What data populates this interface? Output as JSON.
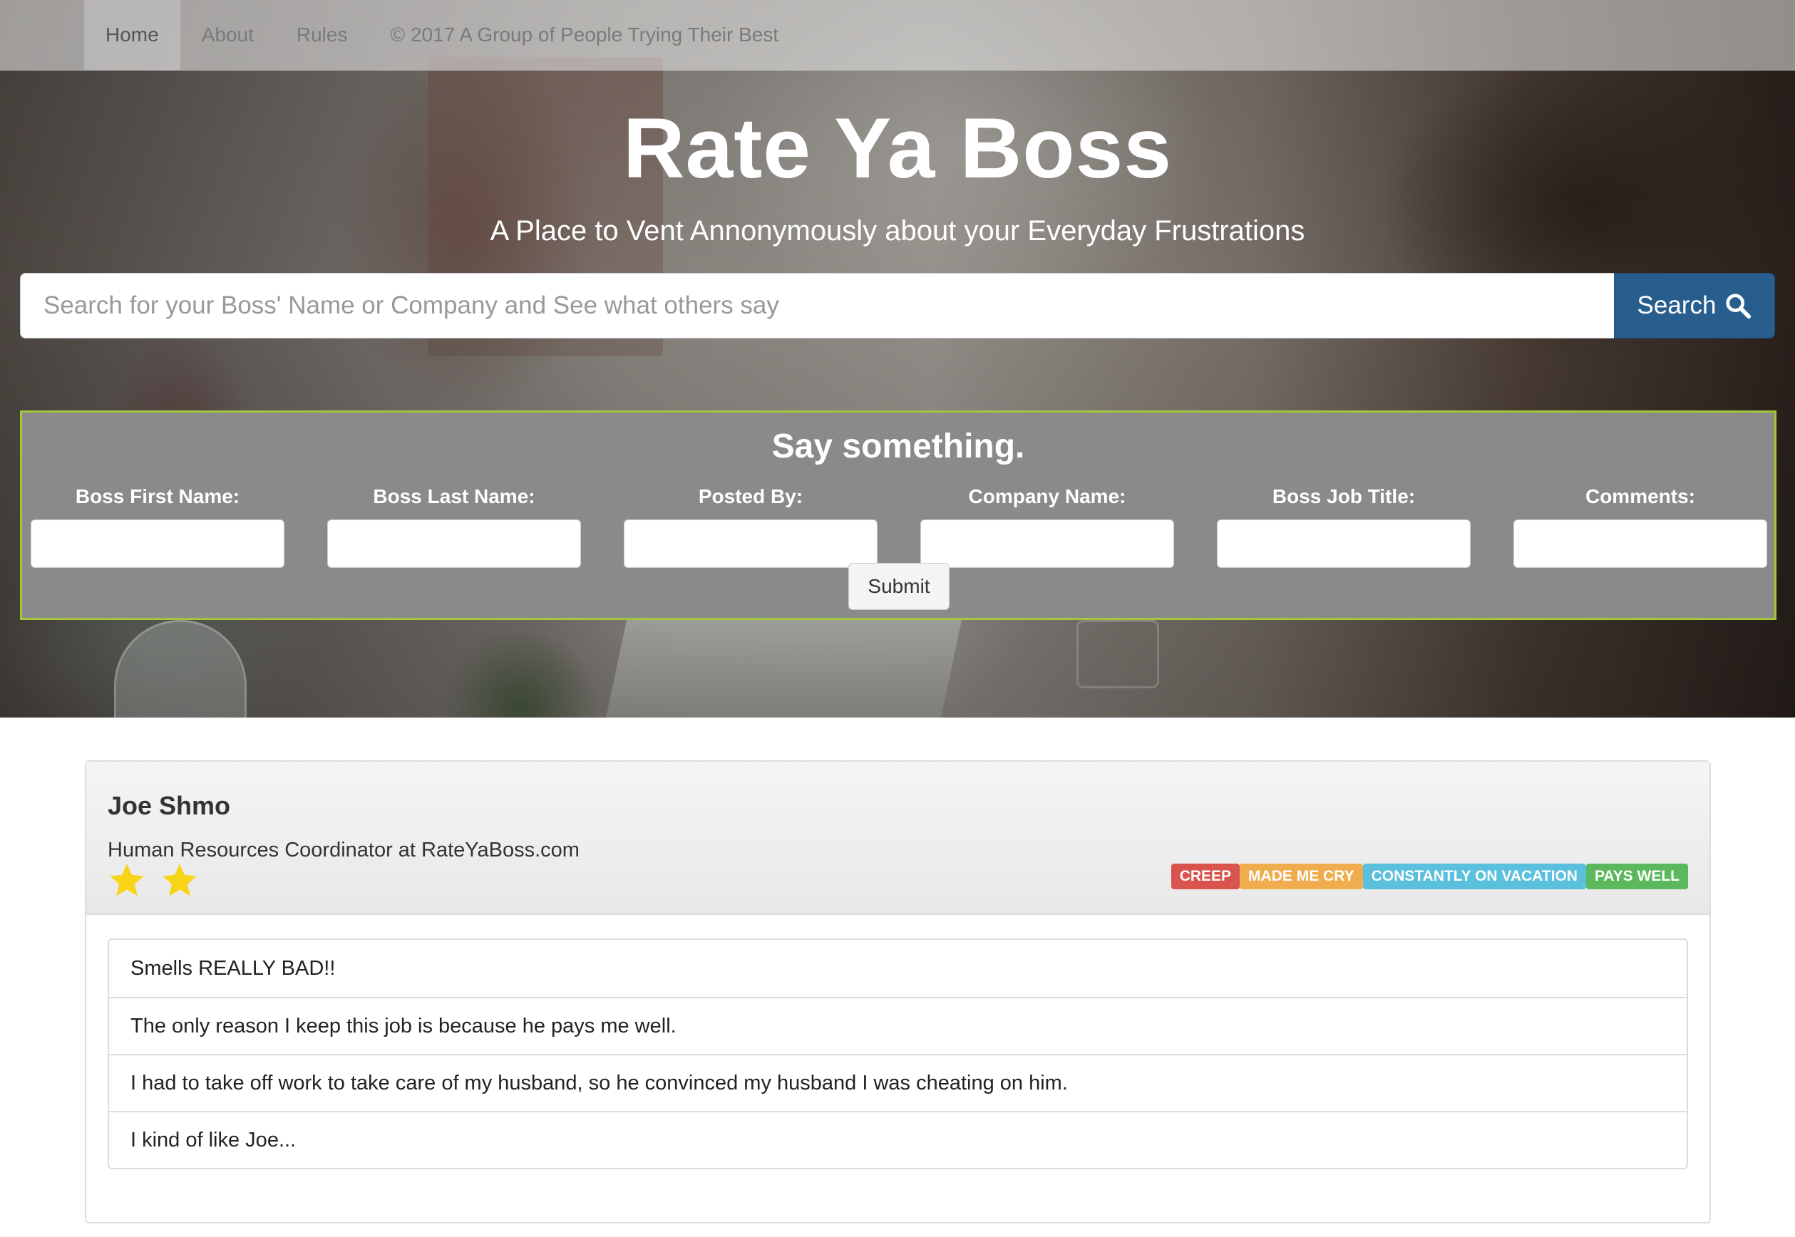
{
  "nav": {
    "items": [
      {
        "label": "Home",
        "active": true
      },
      {
        "label": "About",
        "active": false
      },
      {
        "label": "Rules",
        "active": false
      }
    ],
    "footer_text": "© 2017 A Group of People Trying Their Best"
  },
  "hero": {
    "title": "Rate Ya Boss",
    "subtitle": "A Place to Vent Annonymously about your Everyday Frustrations"
  },
  "search": {
    "placeholder": "Search for your Boss' Name or Company and See what others say",
    "value": "",
    "button_label": "Search",
    "button_icon": "magnifier-icon"
  },
  "form": {
    "heading": "Say something.",
    "fields": [
      {
        "label": "Boss First Name:",
        "value": ""
      },
      {
        "label": "Boss Last Name:",
        "value": ""
      },
      {
        "label": "Posted By:",
        "value": ""
      },
      {
        "label": "Company Name:",
        "value": ""
      },
      {
        "label": "Boss Job Title:",
        "value": ""
      },
      {
        "label": "Comments:",
        "value": ""
      }
    ],
    "submit_label": "Submit",
    "border_color": "#a3c63a"
  },
  "review": {
    "boss_name": "Joe Shmo",
    "job_line": "Human Resources Coordinator at RateYaBoss.com",
    "rating": 2,
    "star_color": "#f7d417",
    "tags": [
      {
        "label": "CREEP",
        "color": "#d9534f"
      },
      {
        "label": "MADE ME CRY",
        "color": "#f0ad4e"
      },
      {
        "label": "CONSTANTLY ON VACATION",
        "color": "#5bc0de"
      },
      {
        "label": "PAYS WELL",
        "color": "#5cb85c"
      }
    ],
    "comments": [
      "Smells REALLY BAD!!",
      "The only reason I keep this job is because he pays me well.",
      "I had to take off work to take care of my husband, so he convinced my husband I was cheating on him.",
      "I kind of like Joe..."
    ]
  },
  "colors": {
    "search_button": "#285e8e",
    "form_panel": "#8a8a8a"
  }
}
